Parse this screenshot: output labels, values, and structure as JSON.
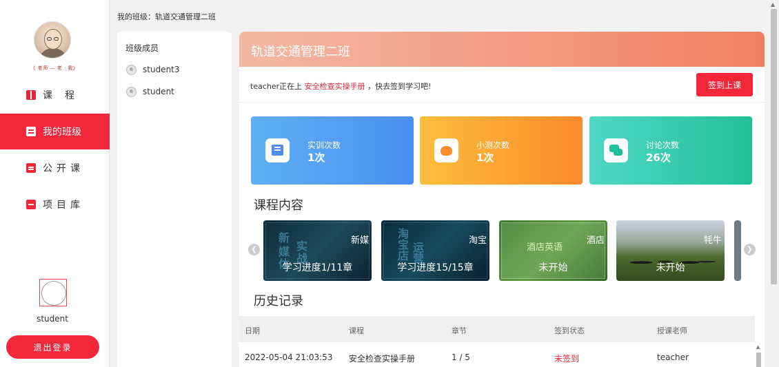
{
  "sidebar": {
    "avatar_caption": "《 老师 — 老 · 我》",
    "nav": [
      {
        "label": "课程",
        "icon": "book-icon"
      },
      {
        "label": "我的班级",
        "icon": "board-icon"
      },
      {
        "label": "公开课",
        "icon": "clipboard-icon"
      },
      {
        "label": "项目库",
        "icon": "folder-icon"
      }
    ],
    "username": "student",
    "logout_label": "退出登录"
  },
  "breadcrumb": "我的班级：轨道交通管理二班",
  "members": {
    "title": "班级成员",
    "items": [
      "student3",
      "student"
    ]
  },
  "main": {
    "class_name": "轨道交通管理二班",
    "notice": {
      "prefix": "teacher正在上",
      "course": "安全检查实操手册",
      "suffix": "，快去签到学习吧!"
    },
    "signin_label": "签到上课",
    "stats": [
      {
        "label": "实训次数",
        "value": "1次",
        "color": "#4a8ff0"
      },
      {
        "label": "小测次数",
        "value": "1次",
        "color": "#fb8a2c"
      },
      {
        "label": "讨论次数",
        "value": "26次",
        "color": "#22c097"
      }
    ],
    "course_section_title": "课程内容",
    "courses": [
      {
        "title": "新媒",
        "progress": "学习进度1/11章"
      },
      {
        "title": "淘宝",
        "progress": "学习进度15/15章"
      },
      {
        "title": "酒店",
        "subtitle": "酒店英语",
        "progress": "未开始"
      },
      {
        "title": "牦牛",
        "progress": "未开始"
      }
    ],
    "history_section_title": "历史记录",
    "history": {
      "headers": [
        "日期",
        "课程",
        "章节",
        "签到状态",
        "授课老师"
      ],
      "rows": [
        [
          "2022-05-04 21:03:53",
          "安全检查实操手册",
          "1 / 5",
          "未签到",
          "teacher"
        ]
      ]
    }
  },
  "colors": {
    "accent": "#f2273a",
    "unsigned": "#e0263a"
  }
}
